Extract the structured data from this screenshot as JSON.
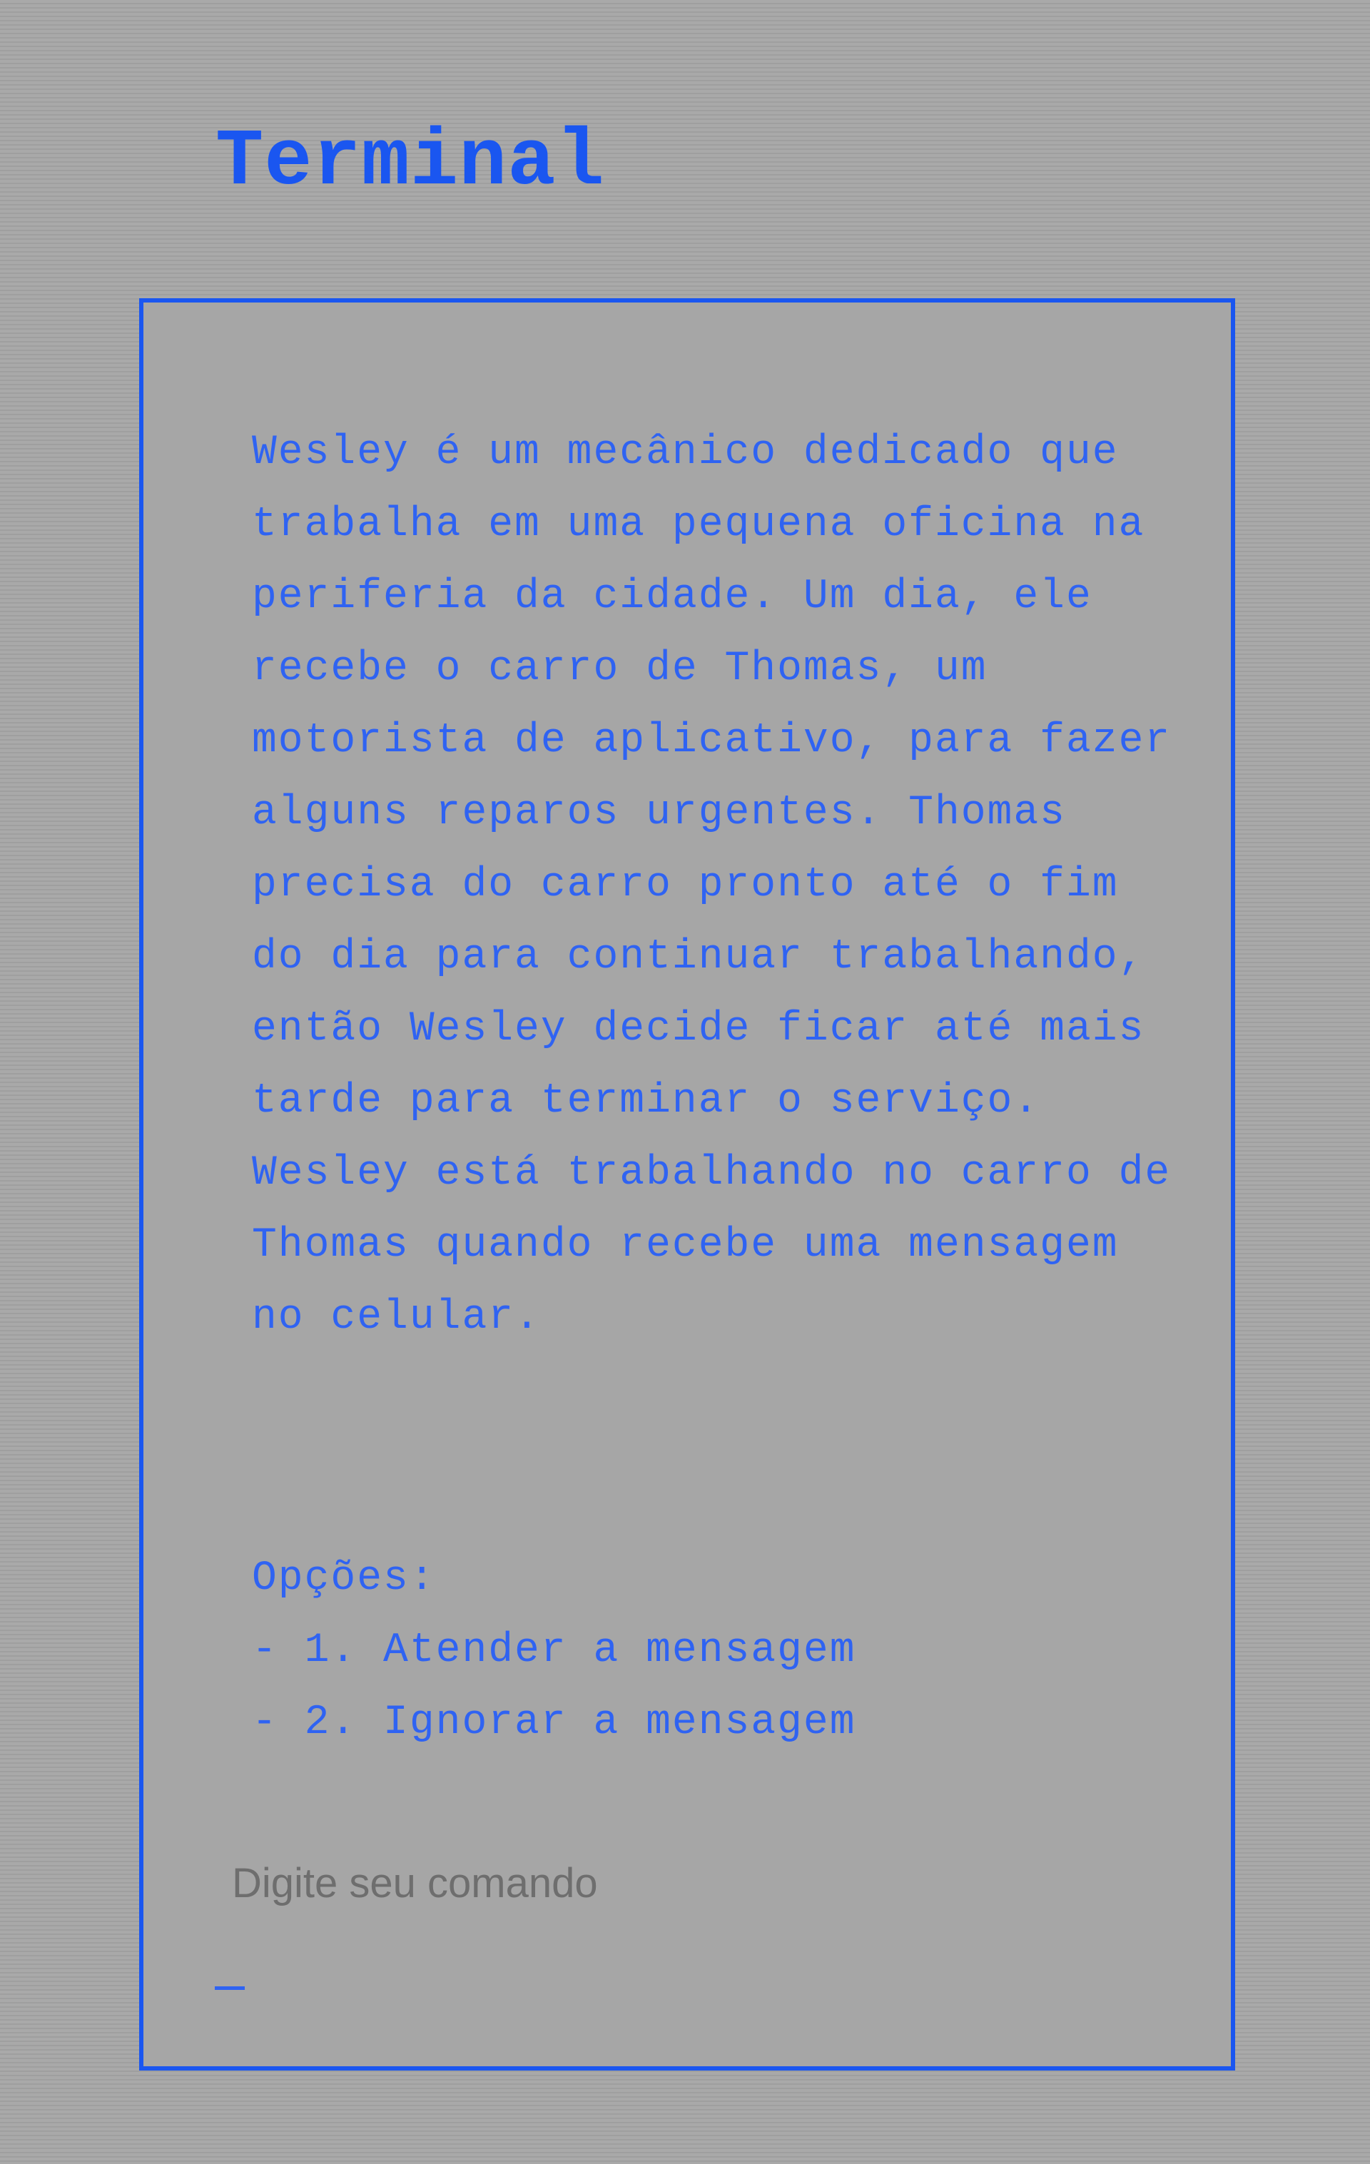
{
  "header": {
    "title": "Terminal"
  },
  "terminal": {
    "story": "Wesley é um mecânico dedicado que trabalha em uma pequena oficina na periferia da cidade. Um dia, ele recebe o carro de Thomas, um motorista de aplicativo, para fazer alguns reparos urgentes. Thomas precisa do carro pronto até o fim do dia para continuar trabalhando, então Wesley decide ficar até mais tarde para terminar o serviço. Wesley está trabalhando no carro de Thomas quando recebe uma mensagem no celular.",
    "options_label": "Opções:",
    "options": [
      "- 1. Atender a mensagem",
      "- 2. Ignorar a mensagem"
    ],
    "prompt": "Digite seu comando",
    "input_value": ""
  },
  "colors": {
    "accent": "#1a56f0",
    "text": "#2f63f2",
    "prompt": "#6e6e6e",
    "background": "#a6a6a6"
  }
}
